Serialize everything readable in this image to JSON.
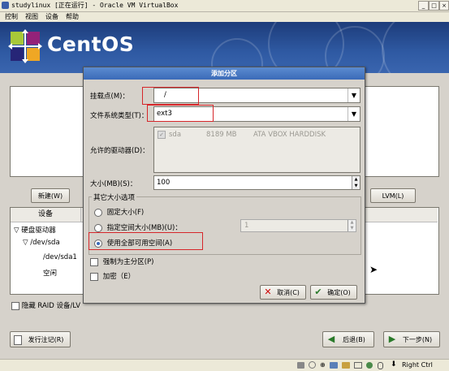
{
  "window": {
    "title": "studylinux [正在运行] - Oracle VM VirtualBox",
    "menu": [
      "控制",
      "视图",
      "设备",
      "帮助"
    ]
  },
  "banner": {
    "logo_text": "CentOS"
  },
  "installer": {
    "buttons": {
      "new": "新建(W)",
      "lvm": "LVM(L)",
      "release_notes": "发行注记(R)",
      "back": "后退(B)",
      "next": "下一步(N)"
    },
    "device_header": "设备",
    "tree": [
      "硬盘驱动器",
      "/dev/sda",
      "/dev/sda1",
      "空闲"
    ],
    "hide_raid": "隐藏 RAID 设备/LV"
  },
  "dialog": {
    "title": "添加分区",
    "mount_point_label": "挂载点(M)：",
    "mount_point_value": "/",
    "fs_type_label": "文件系统类型(T)：",
    "fs_type_value": "ext3",
    "drives_label": "允许的驱动器(D)：",
    "drive": {
      "name": "sda",
      "size": "8189 MB",
      "model": "ATA VBOX HARDDISK",
      "checked": true
    },
    "size_label": "大小(MB)(S)：",
    "size_value": "100",
    "options_group": "其它大小选项",
    "opt_fixed": "固定大小(F)",
    "opt_upto": "指定空间大小(MB)(U)：",
    "opt_upto_value": "1",
    "opt_fill": "使用全部可用空间(A)",
    "selected_option": "使用全部可用空间(A)",
    "force_primary": "强制为主分区(P)",
    "encrypt": "加密（E）",
    "cancel": "取消(C)",
    "ok": "确定(O)"
  },
  "statusbar": {
    "host_key": "Right Ctrl"
  },
  "colors": {
    "accent": "#3b6bb8",
    "highlight": "#d6262a"
  }
}
